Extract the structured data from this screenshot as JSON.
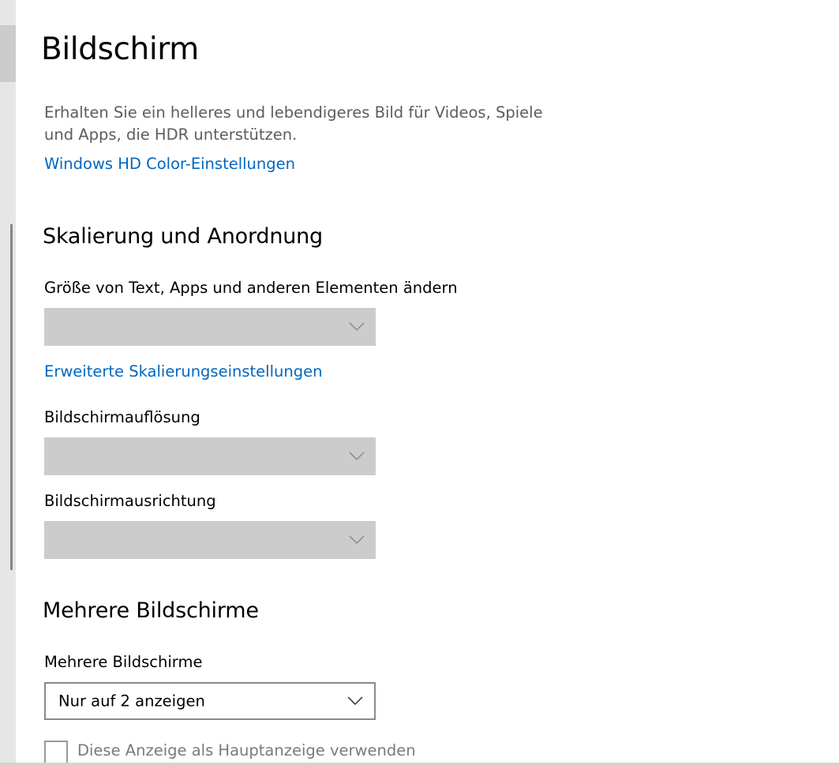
{
  "page": {
    "title": "Bildschirm"
  },
  "hdr": {
    "description": "Erhalten Sie ein helleres und lebendigeres Bild für Videos, Spiele und Apps, die HDR unterstützen.",
    "link_label": "Windows HD Color-Einstellungen"
  },
  "scaling": {
    "section_title": "Skalierung und Anordnung",
    "size_label": "Größe von Text, Apps und anderen Elementen ändern",
    "size_value": "",
    "advanced_link_label": "Erweiterte Skalierungseinstellungen",
    "resolution_label": "Bildschirmauflösung",
    "resolution_value": "",
    "orientation_label": "Bildschirmausrichtung",
    "orientation_value": ""
  },
  "multi": {
    "section_title": "Mehrere Bildschirme",
    "label": "Mehrere Bildschirme",
    "value": "Nur auf 2 anzeigen",
    "main_display_label": "Diese Anzeige als Hauptanzeige verwenden",
    "main_display_checked": false
  },
  "icons": {
    "dropdown_chevron": "chevron-down-icon"
  },
  "colors": {
    "link": "#0067c0",
    "disabled_dropdown": "#cccccc",
    "secondary_text": "#5d5d5d"
  }
}
